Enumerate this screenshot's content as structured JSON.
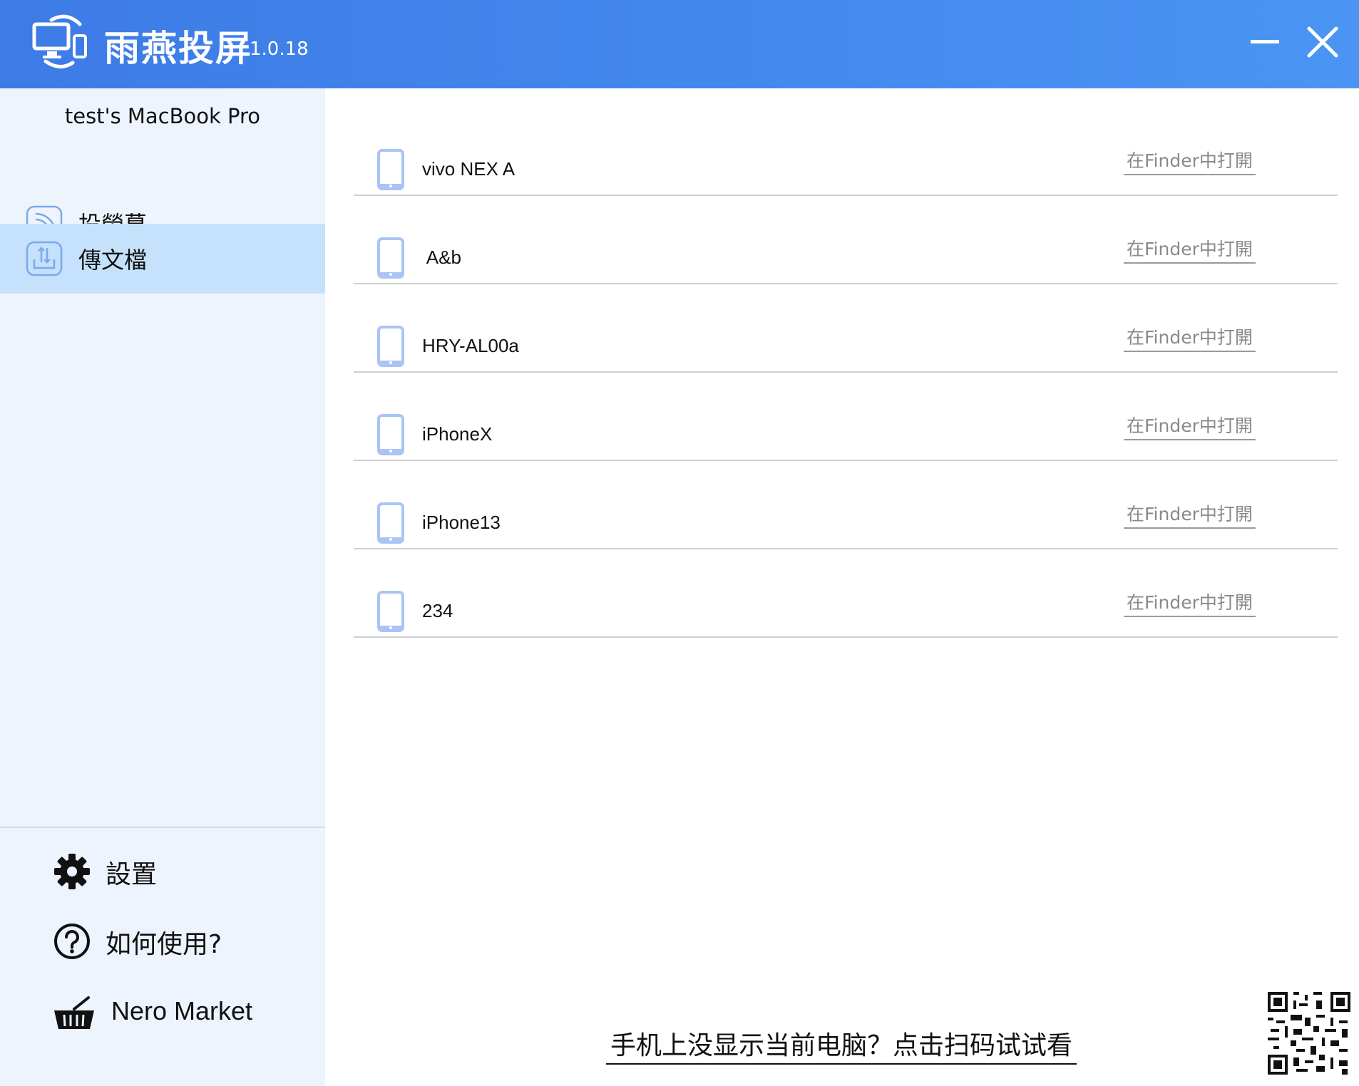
{
  "titlebar": {
    "app_name": "雨燕投屏",
    "version": "1.0.18",
    "icons": {
      "logo": "screen-cast-logo-icon",
      "minimize": "minimize-icon",
      "close": "close-icon"
    }
  },
  "sidebar": {
    "device_name": "test's MacBook Pro",
    "nav": [
      {
        "label": "投熒幕",
        "icon": "cast-screen-icon",
        "active": false
      },
      {
        "label": "傳文檔",
        "icon": "file-transfer-icon",
        "active": true
      }
    ],
    "bottom": [
      {
        "label": "設置",
        "icon": "gear-icon"
      },
      {
        "label": "如何使用?",
        "icon": "help-circle-icon"
      },
      {
        "label": "Nero Market",
        "icon": "basket-icon"
      }
    ]
  },
  "devices": [
    {
      "name": "vivo NEX A",
      "action": "在Finder中打開"
    },
    {
      "name": " A&b",
      "action": "在Finder中打開"
    },
    {
      "name": "HRY-AL00a",
      "action": "在Finder中打開"
    },
    {
      "name": "iPhoneX",
      "action": "在Finder中打開"
    },
    {
      "name": "iPhone13",
      "action": "在Finder中打開"
    },
    {
      "name": "234",
      "action": "在Finder中打開"
    }
  ],
  "footer": {
    "scan_prompt": "手机上没显示当前电脑？点击扫码试试看",
    "qr_icon": "qr-code-icon"
  },
  "colors": {
    "titlebar": "#438aee",
    "sidebar_bg": "#eef4fd",
    "active_nav": "#c5e1fb",
    "phone_icon": "#a9c4f5",
    "link_gray": "#8a8a8a"
  }
}
